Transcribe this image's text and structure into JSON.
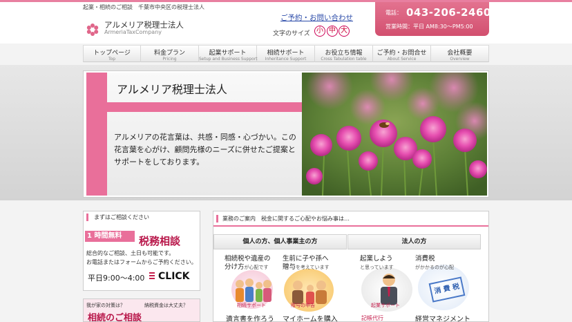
{
  "header": {
    "tagline": "起業・相続のご相談　千葉市中央区の税理士法人",
    "logo_name": "アルメリア税理士法人",
    "logo_en": "ArmeriaTaxCompany",
    "contact_link": "ご予約・お問い合わせ",
    "font_size_label": "文字のサイズ",
    "font_sizes": [
      "小",
      "中",
      "大"
    ],
    "phone_label": "電話：",
    "phone_number": "043-206-2460",
    "hours": "営業時間：平日 AM8:30～PM5:00"
  },
  "nav": [
    {
      "jp": "トップページ",
      "en": "Top"
    },
    {
      "jp": "料金プラン",
      "en": "Pricing"
    },
    {
      "jp": "起業サポート",
      "en": "Setup and Business Support"
    },
    {
      "jp": "相続サポート",
      "en": "Inheritance Support"
    },
    {
      "jp": "お役立ち情報",
      "en": "Cross Tabulation table"
    },
    {
      "jp": "ご予約・お問合せ",
      "en": "About Service"
    },
    {
      "jp": "会社概要",
      "en": "Overview"
    }
  ],
  "hero": {
    "title": "アルメリア税理士法人",
    "text": "アルメリアの花言葉は、共感・同感・心づかい。この花言葉を心がけ、顧問先様のニーズに併せたご提案とサポートをしております。"
  },
  "consult": {
    "title": "まずはご相談ください",
    "free_badge": "1 時間無料",
    "tax_consult": "税務相談",
    "desc1": "総合的なご相談、土日も可能です。",
    "desc2": "お電話またはフォームからご予約ください。",
    "hours": "平日9:00～4:00",
    "click": "CLICK"
  },
  "consult2": {
    "q1": "我が家の対策は？",
    "q2": "納税資金は大丈夫？",
    "title": "相続のご相談"
  },
  "services": {
    "title": "業務のご案内　税金に関するご心配やお悩み事は…",
    "col_individual": "個人の方、個人事業主の方",
    "col_corporate": "法人の方",
    "inherit_label1": "相続税や遺産の",
    "inherit_label2": "分け方",
    "inherit_sub": "が心配です",
    "inherit_cap": "相続サポート",
    "gift_label1": "生前に子や孫へ",
    "gift_label2": "贈与",
    "gift_sub": "を考えています",
    "gift_cap": "贈与の申告",
    "startup_label": "起業しよう",
    "startup_sub": "と思っています",
    "startup_cap": "起業サポート",
    "consumption_label": "消費税",
    "consumption_sub": "がかかるのが心配",
    "consumption_stamp": "消 費 税",
    "will_label": "遺言書を作ろう",
    "home_label": "マイホームを購入",
    "bookkeeping_label": "記帳代行",
    "management_label": "経営マネジメント"
  }
}
